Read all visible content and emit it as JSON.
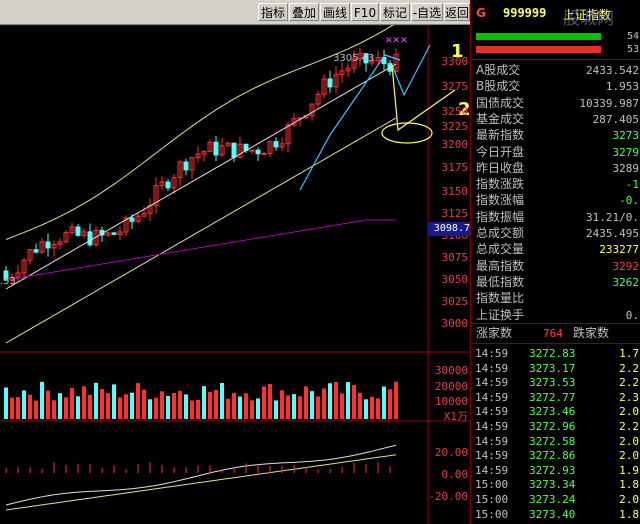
{
  "toolbar": {
    "buttons": [
      "指标",
      "叠加",
      "画线",
      "F10",
      "标记",
      "-自选",
      "返回"
    ]
  },
  "main_chart": {
    "high_label": "3305.43",
    "low_label": ".53",
    "last_price_badge": "3098.7",
    "annotations": [
      "1",
      "2"
    ],
    "price_axis": [
      "3300",
      "3275",
      "3250",
      "3225",
      "3200",
      "3175",
      "3150",
      "3125",
      "3100",
      "3075",
      "3050",
      "3025",
      "3000"
    ],
    "volume_axis": [
      "30000",
      "20000",
      "10000"
    ],
    "volume_unit": "X1万",
    "indicator_axis": [
      "20.00",
      "0.00",
      "-20.00"
    ]
  },
  "side_panel": {
    "header_code": "999999",
    "header_name": "上证指数",
    "header_flag": "G",
    "bar_values": [
      "54",
      "53"
    ],
    "stats": [
      {
        "label": "A股成交",
        "value": "2433.542"
      },
      {
        "label": "B股成交",
        "value": "1.953"
      },
      {
        "label": "国债成交",
        "value": "10339.987"
      },
      {
        "label": "基金成交",
        "value": "287.405"
      },
      {
        "label": "最新指数",
        "value": "3273"
      },
      {
        "label": "今日开盘",
        "value": "3279"
      },
      {
        "label": "昨日收盘",
        "value": "3289"
      },
      {
        "label": "指数涨跌",
        "value": "-1"
      },
      {
        "label": "指数涨幅",
        "value": "-0."
      },
      {
        "label": "指数振幅",
        "value": "31.21/0."
      },
      {
        "label": "总成交额",
        "value": "2435.495"
      },
      {
        "label": "总成交量",
        "value": "233277"
      },
      {
        "label": "最高指数",
        "value": "3292"
      },
      {
        "label": "最低指数",
        "value": "3262"
      },
      {
        "label": "指数量比",
        "value": ""
      },
      {
        "label": "上证换手",
        "value": "0."
      }
    ],
    "rise_label": "涨家数",
    "rise_count": "764",
    "fall_label": "跌家数",
    "ticks": [
      {
        "time": "14:59",
        "price": "3272.83",
        "vol": "1.7"
      },
      {
        "time": "14:59",
        "price": "3273.17",
        "vol": "2.2"
      },
      {
        "time": "14:59",
        "price": "3273.53",
        "vol": "2.2"
      },
      {
        "time": "14:59",
        "price": "3272.77",
        "vol": "2.3"
      },
      {
        "time": "14:59",
        "price": "3273.46",
        "vol": "2.0"
      },
      {
        "time": "14:59",
        "price": "3272.96",
        "vol": "2.2"
      },
      {
        "time": "14:59",
        "price": "3272.58",
        "vol": "2.0"
      },
      {
        "time": "14:59",
        "price": "3272.86",
        "vol": "2.0"
      },
      {
        "time": "14:59",
        "price": "3272.93",
        "vol": "1.9"
      },
      {
        "time": "15:00",
        "price": "3273.34",
        "vol": "1.8"
      },
      {
        "time": "15:00",
        "price": "3273.24",
        "vol": "2.0"
      },
      {
        "time": "15:00",
        "price": "3273.40",
        "vol": "1.8"
      }
    ],
    "watermark": "股城网"
  },
  "colors": {
    "up": "#ff3030",
    "down": "#54ffff",
    "boll": "#e0e090",
    "ma": "#e0e0e0",
    "purple": "#b000b0",
    "green_bar": "#00c000"
  }
}
